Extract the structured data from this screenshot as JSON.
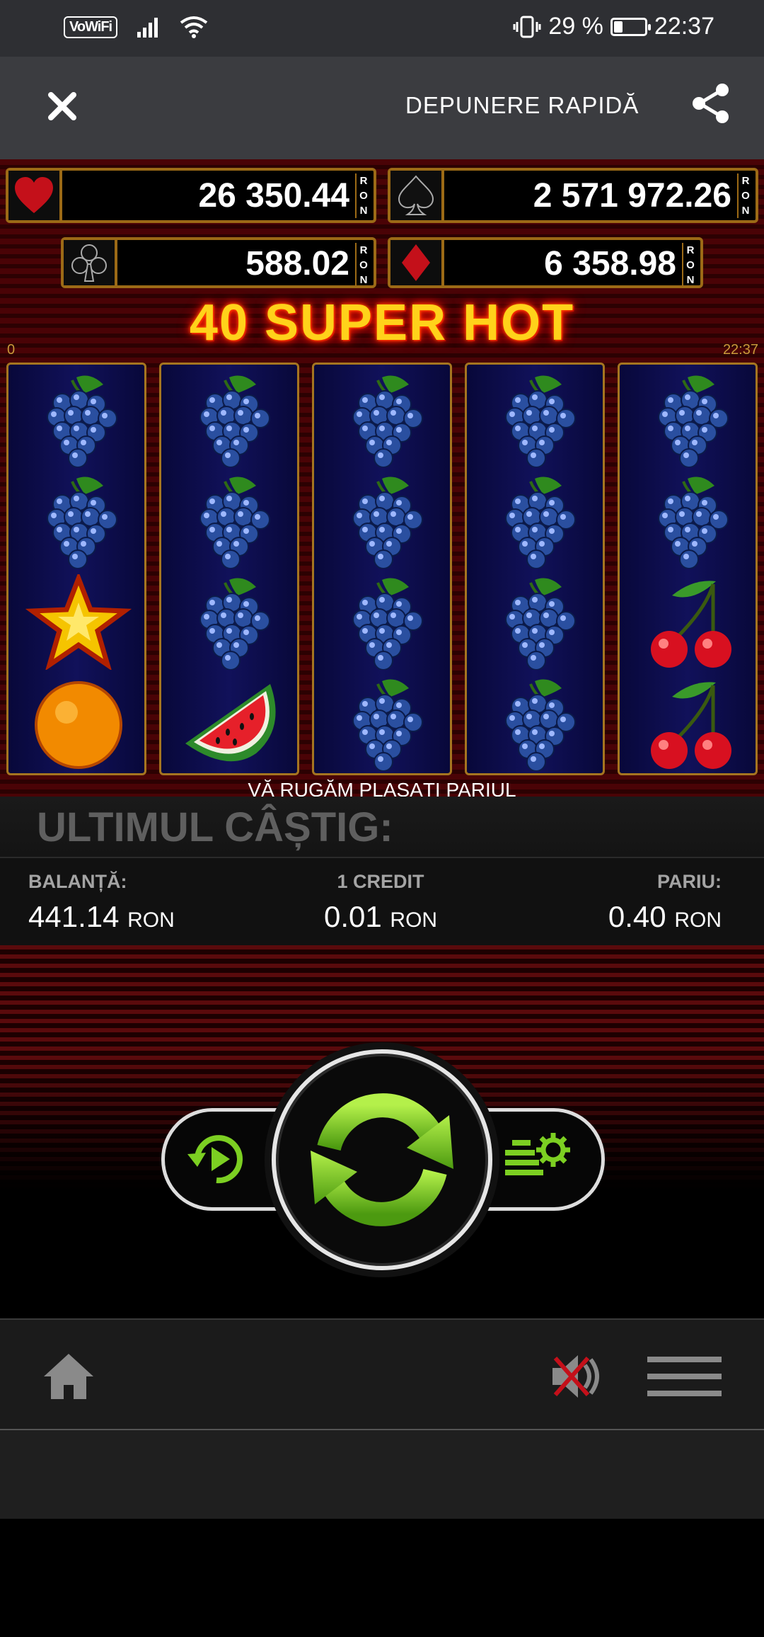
{
  "status": {
    "wifi_label": "VoWiFi",
    "battery_text": "29 %",
    "battery_level": 0.29,
    "time": "22:37"
  },
  "appbar": {
    "title": "DEPUNERE RAPIDĂ"
  },
  "jackpots": {
    "hearts": {
      "value": "26 350.44",
      "currency": "RON"
    },
    "spades": {
      "value": "2 571 972.26",
      "currency": "RON"
    },
    "clubs": {
      "value": "588.02",
      "currency": "RON"
    },
    "diamonds": {
      "value": "6 358.98",
      "currency": "RON"
    }
  },
  "game": {
    "title": "40 SUPER HOT",
    "left_counter": "0",
    "clock": "22:37",
    "reels": [
      [
        "grapes",
        "grapes",
        "star",
        "orange"
      ],
      [
        "grapes",
        "grapes",
        "grapes",
        "watermelon"
      ],
      [
        "grapes",
        "grapes",
        "grapes",
        "grapes"
      ],
      [
        "grapes",
        "grapes",
        "grapes",
        "grapes"
      ],
      [
        "grapes",
        "grapes",
        "cherries",
        "cherries"
      ]
    ],
    "message": "VĂ RUGĂM PLASAȚI PARIUL"
  },
  "last_win": {
    "label": "ULTIMUL CÂȘTIG:"
  },
  "info": {
    "balance_label": "BALANȚĂ:",
    "balance_value": "441.14",
    "credit_label": "1 CREDIT",
    "credit_value": "0.01",
    "bet_label": "PARIU:",
    "bet_value": "0.40",
    "currency": "RON"
  },
  "controls": {
    "autoplay_icon": "autoplay-icon",
    "spin_icon": "spin-icon",
    "settings_icon": "bet-settings-icon",
    "accent": "#7ccf22"
  },
  "nav": {
    "home_icon": "home-icon",
    "sound_icon": "sound-muted-icon",
    "menu_icon": "menu-icon"
  }
}
